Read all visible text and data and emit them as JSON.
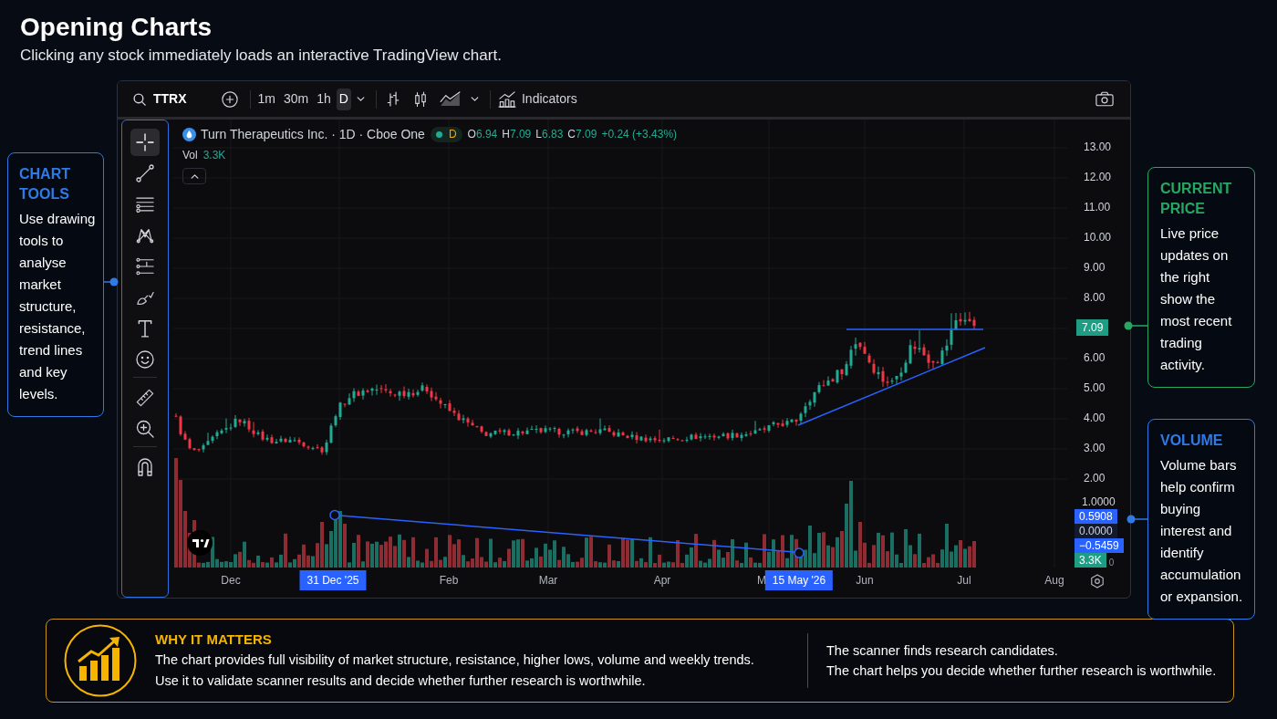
{
  "header": {
    "title": "Opening Charts",
    "subtitle": "Clicking any stock immediately loads an interactive TradingView chart."
  },
  "toolbar": {
    "symbol": "TTRX",
    "intervals": [
      {
        "label": "1m",
        "selected": false
      },
      {
        "label": "30m",
        "selected": false
      },
      {
        "label": "1h",
        "selected": false
      },
      {
        "label": "D",
        "selected": true
      }
    ],
    "indicators": "Indicators"
  },
  "drawing_tools": {
    "groups": [
      {
        "tools": [
          {
            "kind": "crosshair",
            "selected": true
          },
          {
            "kind": "trend_line",
            "selected": false
          },
          {
            "kind": "horizontal_lines",
            "selected": false
          },
          {
            "kind": "pattern",
            "selected": false
          },
          {
            "kind": "projection",
            "selected": false
          },
          {
            "kind": "brush",
            "selected": false
          },
          {
            "kind": "text",
            "selected": false
          },
          {
            "kind": "emoji",
            "selected": false
          }
        ]
      },
      {
        "tools": [
          {
            "kind": "measure",
            "selected": false
          },
          {
            "kind": "zoom",
            "selected": false
          }
        ]
      },
      {
        "tools": [
          {
            "kind": "magnet",
            "selected": false
          }
        ]
      }
    ]
  },
  "legend": {
    "title": "Turn Therapeutics Inc. · 1D · Cboe One",
    "market_status": "D",
    "ohlc": [
      {
        "key": "O",
        "value": "6.94"
      },
      {
        "key": "H",
        "value": "7.09"
      },
      {
        "key": "L",
        "value": "6.83"
      },
      {
        "key": "C",
        "value": "7.09"
      }
    ],
    "change": "+0.24 (+3.43%)",
    "volume": {
      "label": "Vol",
      "value": "3.3K"
    }
  },
  "price_scale": {
    "labels": [
      {
        "text": "13.00",
        "kind": "tick"
      },
      {
        "text": "12.00",
        "kind": "tick"
      },
      {
        "text": "11.00",
        "kind": "tick"
      },
      {
        "text": "10.00",
        "kind": "tick"
      },
      {
        "text": "9.00",
        "kind": "tick"
      },
      {
        "text": "8.00",
        "kind": "tick"
      },
      {
        "text": "7.09",
        "kind": "last_price"
      },
      {
        "text": "6.00",
        "kind": "tick"
      },
      {
        "text": "5.00",
        "kind": "tick"
      },
      {
        "text": "4.00",
        "kind": "tick"
      },
      {
        "text": "3.00",
        "kind": "tick"
      },
      {
        "text": "2.00",
        "kind": "tick"
      }
    ]
  },
  "volume_scale": {
    "labels": [
      {
        "text": "1.0000",
        "kind": "tick"
      },
      {
        "text": "0.5908",
        "kind": "drawing"
      },
      {
        "text": "0.0000",
        "kind": "zero"
      },
      {
        "text": "−0.5459",
        "kind": "drawing"
      },
      {
        "text": "3.3K",
        "kind": "last_volume"
      }
    ],
    "cut_label": "0"
  },
  "time_scale": {
    "labels": [
      {
        "text": "Dec",
        "kind": "month"
      },
      {
        "text": "31 Dec '25",
        "kind": "drawing"
      },
      {
        "text": "Feb",
        "kind": "month"
      },
      {
        "text": "Mar",
        "kind": "month"
      },
      {
        "text": "Apr",
        "kind": "month"
      },
      {
        "text": "M",
        "kind": "month"
      },
      {
        "text": "15 May '26",
        "kind": "drawing"
      },
      {
        "text": "Jun",
        "kind": "month"
      },
      {
        "text": "Jul",
        "kind": "month"
      },
      {
        "text": "Aug",
        "kind": "month"
      }
    ]
  },
  "callouts": [
    {
      "title": "CHART TOOLS",
      "body": "Use drawing tools to analyse market structure, resistance, trend lines and key levels.",
      "color": "#2f7ae5"
    },
    {
      "title": "CURRENT PRICE",
      "body": "Live price updates on the right show the most recent trading activity.",
      "color": "#27a862"
    },
    {
      "title": "VOLUME",
      "body": "Volume bars help confirm buying interest and identify accumulation or expansion.",
      "color": "#2f7ae5"
    }
  ],
  "why_it_matters": {
    "title": "WHY IT MATTERS",
    "lines": [
      "The chart provides full visibility of market structure, resistance, higher lows, volume and weekly trends.",
      "Use it to validate scanner results and decide whether further research is worthwhile."
    ],
    "notes": [
      "The scanner finds research candidates.",
      "The chart helps you decide whether further research is worthwhile."
    ]
  }
}
